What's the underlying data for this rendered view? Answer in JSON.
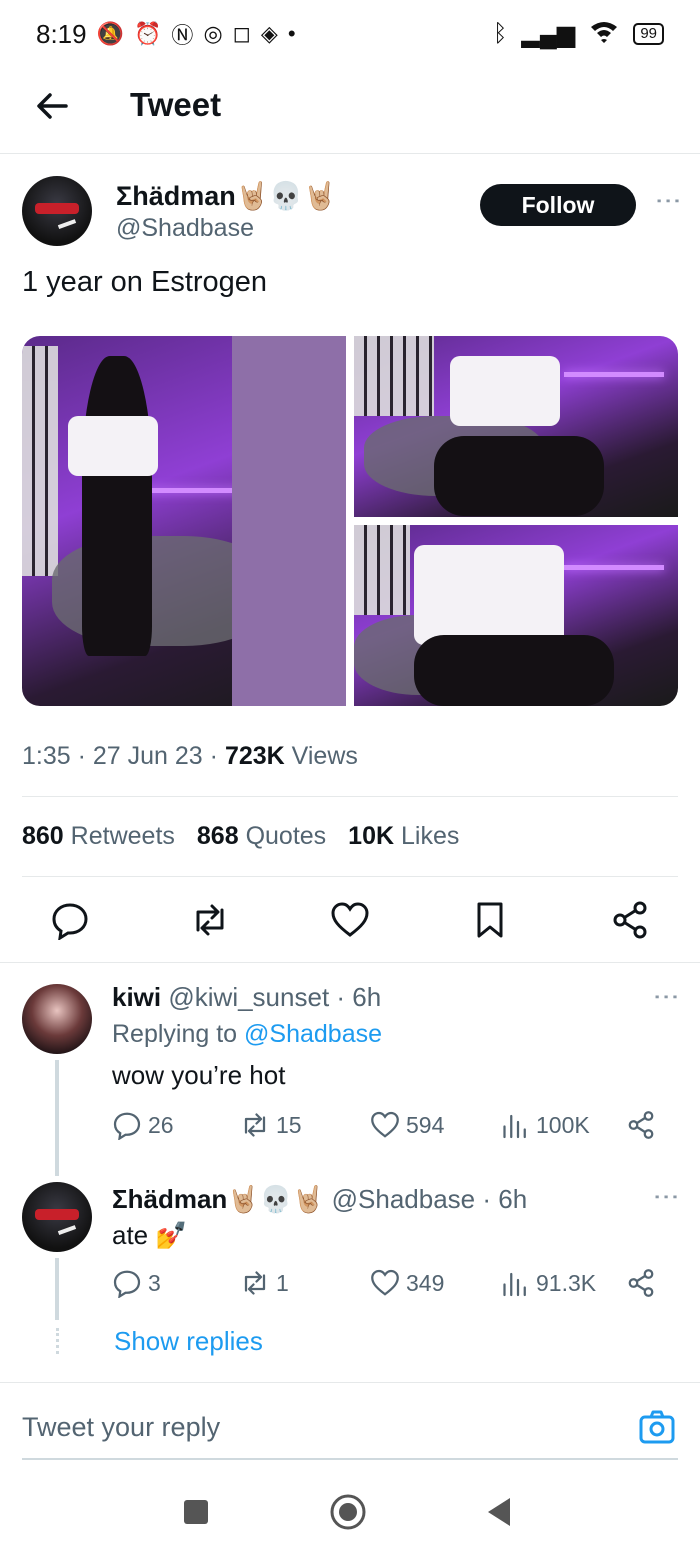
{
  "status_bar": {
    "time": "8:19",
    "battery": "99",
    "left_icons": [
      "mute-alarm-icon",
      "alarm-icon",
      "nfc-icon",
      "whatsapp-icon",
      "instagram-icon",
      "app-icon",
      "dot-icon"
    ],
    "right_icons": [
      "bluetooth-icon",
      "signal-icon",
      "wifi-icon",
      "battery-icon"
    ]
  },
  "header": {
    "title": "Tweet"
  },
  "tweet": {
    "author_name": "Σhädman🤘🏼💀🤘🏼",
    "author_handle": "@Shadbase",
    "follow_label": "Follow",
    "text": "1 year on Estrogen",
    "time": "1:35",
    "date": "27 Jun 23",
    "views_count": "723K",
    "views_label": "Views",
    "retweets_count": "860",
    "retweets_label": "Retweets",
    "quotes_count": "868",
    "quotes_label": "Quotes",
    "likes_count": "10K",
    "likes_label": "Likes"
  },
  "replies": [
    {
      "name": "kiwi",
      "handle": "@kiwi_sunset",
      "age": "6h",
      "replying_to_label": "Replying to",
      "replying_to_handle": "@Shadbase",
      "text": "wow you’re hot",
      "replies": "26",
      "retweets": "15",
      "likes": "594",
      "views": "100K"
    },
    {
      "name": "Σhädman🤘🏼💀🤘🏼",
      "handle": "@Shadbase",
      "age": "6h",
      "text": "ate 💅",
      "replies": "3",
      "retweets": "1",
      "likes": "349",
      "views": "91.3K"
    }
  ],
  "show_replies_label": "Show replies",
  "reply_box": {
    "placeholder": "Tweet your reply"
  },
  "colors": {
    "accent": "#1d9bf0",
    "text": "#0f1419",
    "secondary": "#536471",
    "border": "#e6e9ea"
  }
}
